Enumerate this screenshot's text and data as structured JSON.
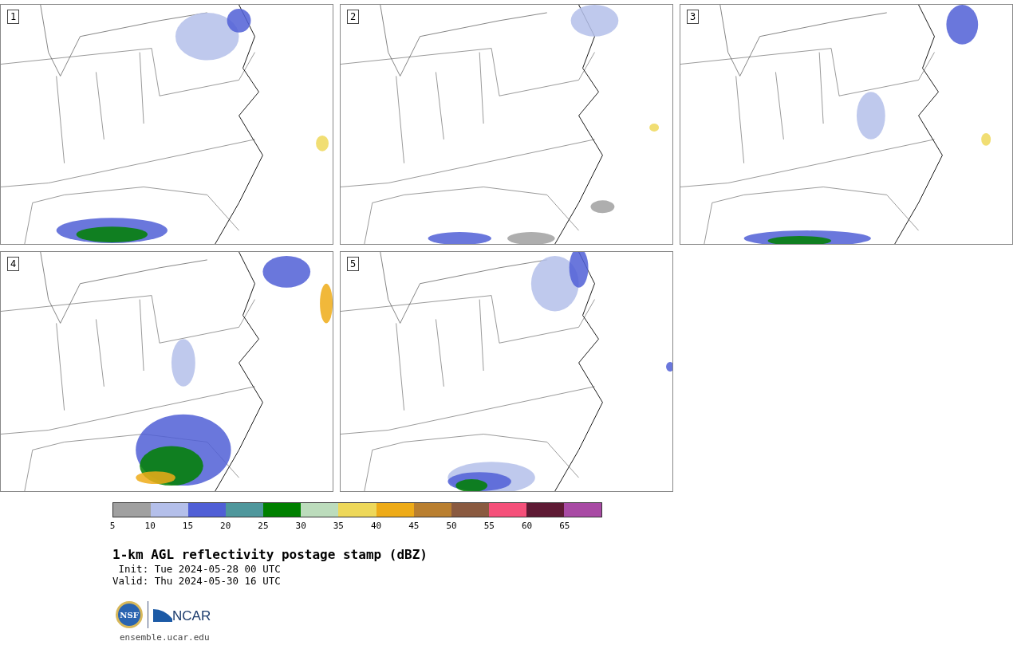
{
  "panels": [
    {
      "label": "1"
    },
    {
      "label": "2"
    },
    {
      "label": "3"
    },
    {
      "label": "4"
    },
    {
      "label": "5"
    }
  ],
  "colorbar": {
    "segments": [
      {
        "color": "#a0a0a0"
      },
      {
        "color": "#b4bfea"
      },
      {
        "color": "#505fd6"
      },
      {
        "color": "#4f979c"
      },
      {
        "color": "#008000"
      },
      {
        "color": "#bcdcbc"
      },
      {
        "color": "#eed85a"
      },
      {
        "color": "#eeab18"
      },
      {
        "color": "#b97f30"
      },
      {
        "color": "#8a5a40"
      },
      {
        "color": "#f5507a"
      },
      {
        "color": "#5e1a34"
      },
      {
        "color": "#a84aa4"
      }
    ],
    "ticks": [
      "5",
      "10",
      "15",
      "20",
      "25",
      "30",
      "35",
      "40",
      "45",
      "50",
      "55",
      "60",
      "65"
    ]
  },
  "title": "1-km AGL reflectivity postage stamp (dBZ)",
  "init": " Init: Tue 2024-05-28 00 UTC",
  "valid": "Valid: Thu 2024-05-30 16 UTC",
  "logo": {
    "nsf": "NSF",
    "ncar": "NCAR"
  },
  "site": "ensemble.ucar.edu"
}
